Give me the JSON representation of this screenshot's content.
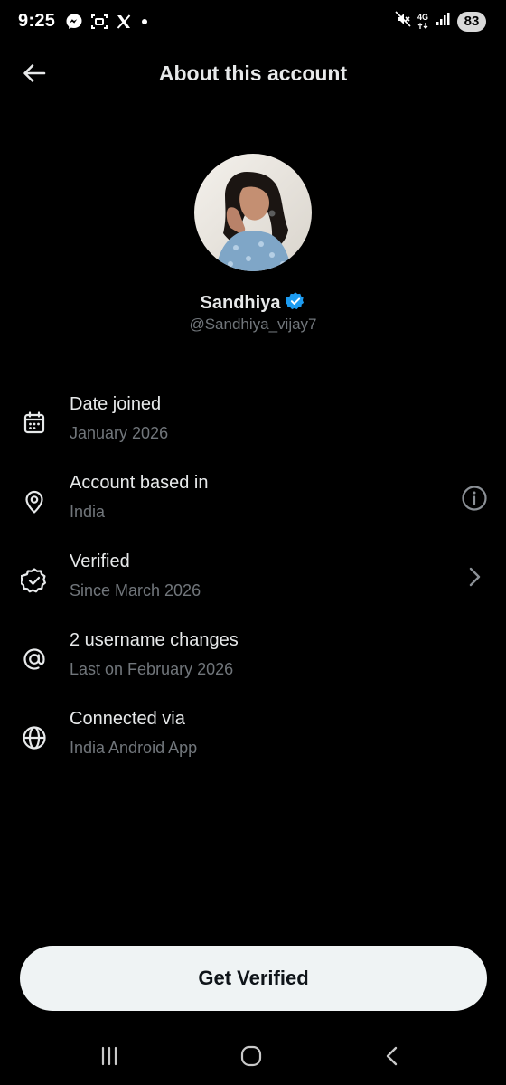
{
  "status_bar": {
    "time": "9:25",
    "network_label": "4G",
    "battery": "83",
    "left_icons": [
      "messenger-icon",
      "screenshot-icon",
      "x-logo-icon",
      "dot-icon"
    ],
    "right_icons": [
      "mute-icon",
      "network-icon",
      "signal-icon",
      "battery-icon"
    ]
  },
  "header": {
    "title": "About this account",
    "back_icon": "arrow-left-icon"
  },
  "profile": {
    "display_name": "Sandhiya",
    "handle": "@Sandhiya_vijay7",
    "verified_badge_color": "#1d9bf0"
  },
  "info_items": [
    {
      "icon": "calendar-icon",
      "title": "Date joined",
      "subtitle": "January 2026"
    },
    {
      "icon": "location-pin-icon",
      "title": "Account based in",
      "subtitle": "India",
      "action_icon": "info-icon"
    },
    {
      "icon": "verified-badge-icon",
      "title": "Verified",
      "subtitle": "Since March 2026",
      "action_icon": "chevron-right-icon"
    },
    {
      "icon": "at-sign-icon",
      "title": "2 username changes",
      "subtitle": "Last on February 2026"
    },
    {
      "icon": "globe-icon",
      "title": "Connected via",
      "subtitle": "India Android App"
    }
  ],
  "get_verified_label": "Get Verified",
  "nav_bar": [
    "recent-apps-icon",
    "home-icon",
    "back-icon"
  ],
  "colors": {
    "background": "#000000",
    "primary_text": "#e7e9ea",
    "secondary_text": "#71767b",
    "button_bg": "#eff3f4",
    "button_text": "#0f1419",
    "accent": "#1d9bf0"
  }
}
